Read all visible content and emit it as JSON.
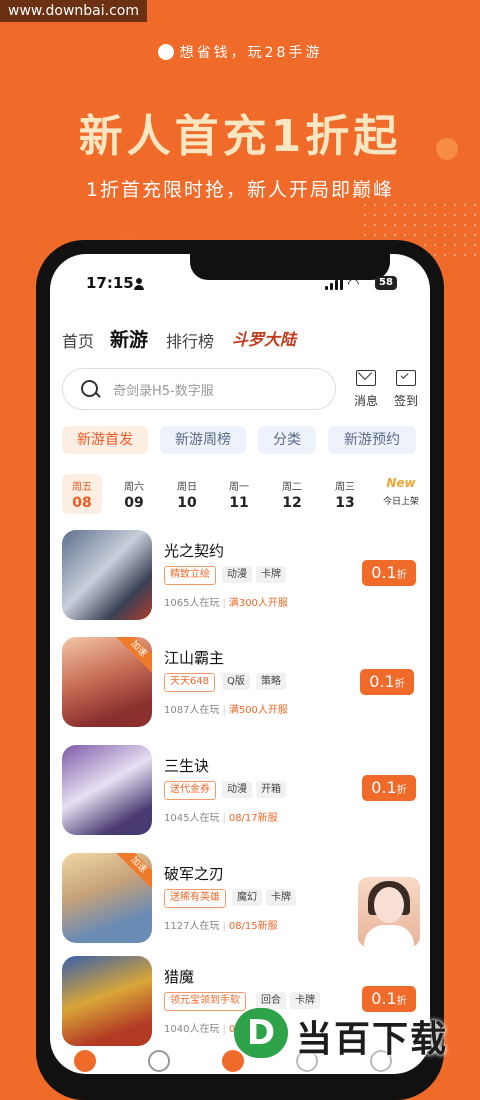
{
  "watermark": "www.downbai.com",
  "promo": {
    "slogan": "想省钱，玩28手游",
    "headline": "新人首充1折起",
    "subline": "1折首充限时抢，新人开局即巅峰"
  },
  "status_bar": {
    "time": "17:15",
    "battery": "58"
  },
  "top_nav": {
    "items": [
      "首页",
      "新游",
      "排行榜"
    ],
    "active": "新游",
    "logo_text": "斗罗大陆"
  },
  "search": {
    "placeholder": "奇剑录H5-数字服"
  },
  "header_icons": {
    "messages_label": "消息",
    "checkin_label": "签到"
  },
  "tabs": [
    "新游首发",
    "新游周榜",
    "分类",
    "新游预约"
  ],
  "days": [
    {
      "weekday": "周五",
      "date": "08"
    },
    {
      "weekday": "周六",
      "date": "09"
    },
    {
      "weekday": "周日",
      "date": "10"
    },
    {
      "weekday": "周一",
      "date": "11"
    },
    {
      "weekday": "周二",
      "date": "12"
    },
    {
      "weekday": "周三",
      "date": "13"
    }
  ],
  "today_new": {
    "badge": "New",
    "label": "今日上架"
  },
  "games": [
    {
      "name": "光之契约",
      "highlight_tag": "精致立绘",
      "tags": [
        "动漫",
        "卡牌"
      ],
      "players": "1065人在玩",
      "note": "满300人开服",
      "price": "0.1",
      "price_unit": "折"
    },
    {
      "name": "江山霸主",
      "badge": "加速",
      "highlight_tag": "天天648",
      "tags": [
        "Q版",
        "策略"
      ],
      "players": "1087人在玩",
      "note": "满500人开服",
      "price": "0.1",
      "price_unit": "折"
    },
    {
      "name": "三生诀",
      "highlight_tag": "送代金券",
      "tags": [
        "动漫",
        "开箱"
      ],
      "players": "1045人在玩",
      "note": "08/17新服",
      "price": "0.1",
      "price_unit": "折"
    },
    {
      "name": "破军之刃",
      "badge": "加速",
      "highlight_tag": "送稀有英雄",
      "tags": [
        "魔幻",
        "卡牌"
      ],
      "players": "1127人在玩",
      "note": "08/15新服"
    },
    {
      "name": "猎魔",
      "highlight_tag": "领元宝领到手软",
      "tags": [
        "回合",
        "卡牌"
      ],
      "players": "1040人在玩",
      "note": "08/",
      "price": "0.1",
      "price_unit": "折"
    }
  ],
  "download_brand": {
    "logo_letter": "D",
    "text": "当百下载"
  },
  "colors": {
    "accent": "#f06a2a",
    "background": "#f06a2a",
    "headline": "#fbe6c2"
  }
}
